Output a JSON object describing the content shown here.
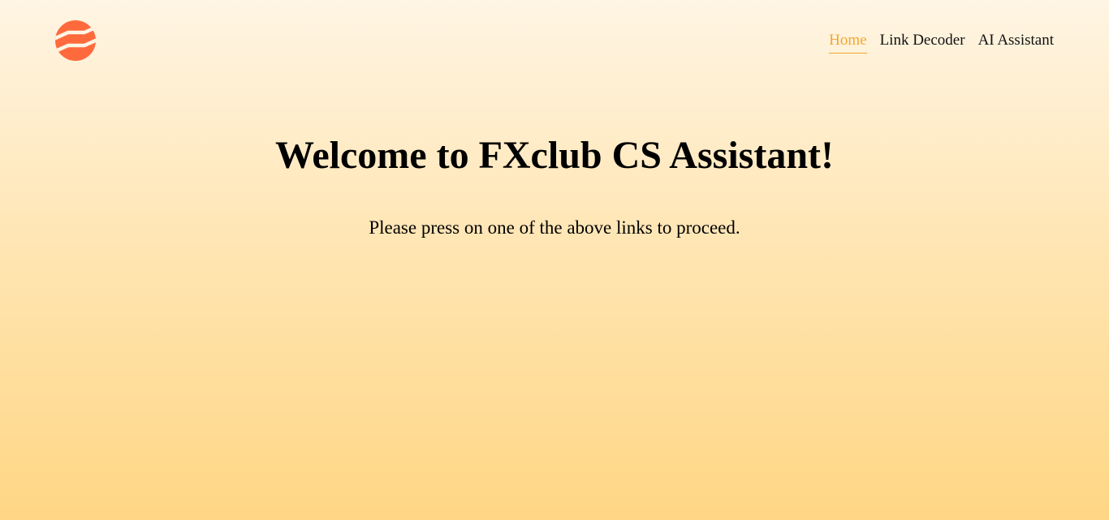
{
  "brand": {
    "logo_icon": "fxclub-logo-icon",
    "logo_color": "#ff6a3d"
  },
  "nav": {
    "items": [
      {
        "label": "Home",
        "active": true
      },
      {
        "label": "Link Decoder",
        "active": false
      },
      {
        "label": "AI Assistant",
        "active": false
      }
    ],
    "active_color": "#f0a830"
  },
  "main": {
    "title": "Welcome to FXclub CS Assistant!",
    "subtitle": "Please press on one of the above links to proceed."
  }
}
